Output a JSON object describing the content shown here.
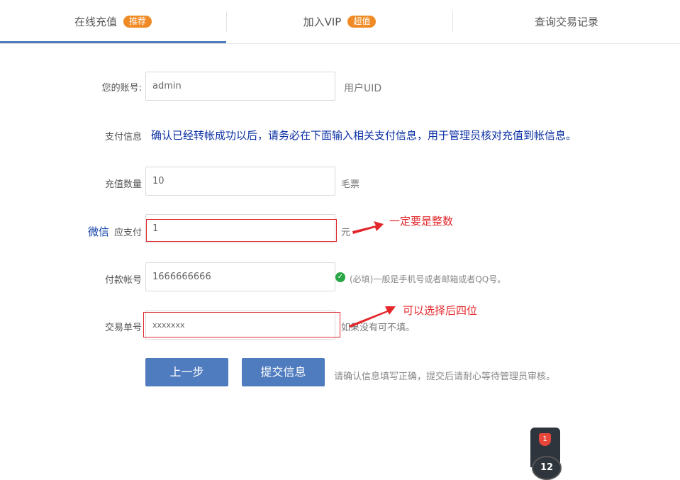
{
  "tabs": [
    {
      "label": "在线充值",
      "badge": "推荐",
      "active": true
    },
    {
      "label": "加入VIP",
      "badge": "超值",
      "active": false
    },
    {
      "label": "查询交易记录",
      "badge": "",
      "active": false
    }
  ],
  "form": {
    "account": {
      "label": "您的账号:",
      "value": "admin",
      "suffix": "用户UID"
    },
    "payinfo": {
      "label": "支付信息",
      "notice": "确认已经转帐成功以后，请务必在下面输入相关支付信息，用于管理员核对充值到帐信息。"
    },
    "amount": {
      "label": "充值数量",
      "value": "10",
      "suffix": "毛票"
    },
    "pay": {
      "prefix": "微信",
      "label": "应支付",
      "value": "1",
      "suffix": "元"
    },
    "payer": {
      "label": "付款帐号",
      "value": "1666666666",
      "hint": "(必填)一般是手机号或者邮箱或者QQ号。"
    },
    "txn": {
      "label": "交易单号",
      "value": "xxxxxxx",
      "hint": "如果没有可不填。"
    }
  },
  "annotations": {
    "pay_note": "一定要是整数",
    "txn_note": "可以选择后四位"
  },
  "buttons": {
    "prev": "上一步",
    "submit": "提交信息"
  },
  "footer_hint": "请确认信息填写正确，提交后请耐心等待管理员审核。",
  "widget": {
    "shield_count": "1",
    "bubble_count": "12"
  },
  "colors": {
    "accent": "#4f7bbf",
    "badge": "#f08a24",
    "annotation": "#e3262a",
    "notice": "#0a2fa3"
  }
}
